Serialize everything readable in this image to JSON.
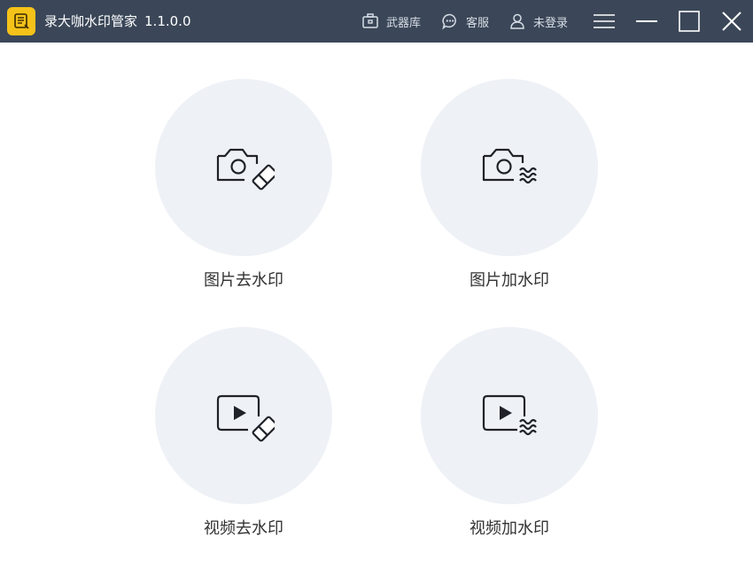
{
  "app": {
    "name": "录大咖水印管家",
    "version": "1.1.0.0"
  },
  "toolbar": {
    "arsenal_label": "武器库",
    "support_label": "客服",
    "login_label": "未登录"
  },
  "features": [
    {
      "label": "图片去水印",
      "icon": "camera-eraser-icon"
    },
    {
      "label": "图片加水印",
      "icon": "camera-waves-icon"
    },
    {
      "label": "视频去水印",
      "icon": "video-eraser-icon"
    },
    {
      "label": "视频加水印",
      "icon": "video-waves-icon"
    }
  ],
  "colors": {
    "titlebar": "#3b4758",
    "logo": "#f5c21a",
    "circle": "#eef1f6",
    "label": "#333333"
  }
}
